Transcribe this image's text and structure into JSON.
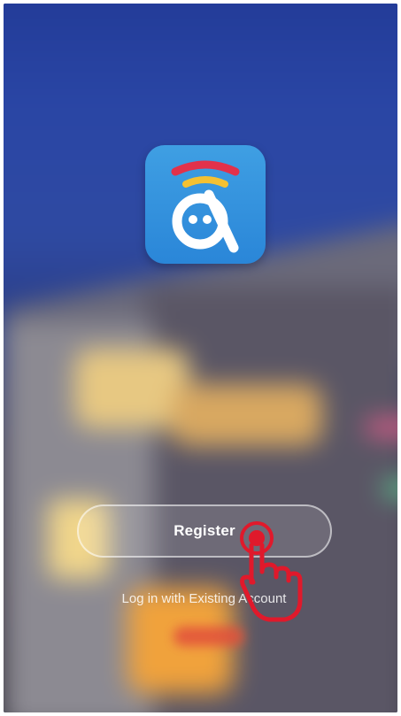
{
  "screen": {
    "register_label": "Register",
    "login_label": "Log in with Existing Account"
  },
  "icons": {
    "logo": "app-logo-icon",
    "gesture": "tap-hand-icon"
  },
  "colors": {
    "logo_background": "#2a86d8",
    "gesture_red": "#e0192b",
    "signal_red": "#e2314b",
    "signal_yellow": "#f4c132"
  }
}
